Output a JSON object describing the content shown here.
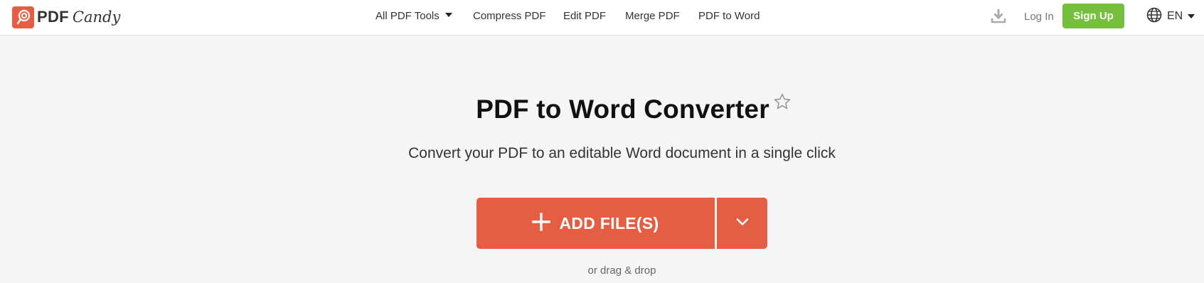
{
  "brand": {
    "name_bold": "PDF",
    "name_italic": "Candy"
  },
  "nav": {
    "all_tools": "All PDF Tools",
    "items": [
      "Compress PDF",
      "Edit PDF",
      "Merge PDF",
      "PDF to Word"
    ]
  },
  "header_right": {
    "login": "Log In",
    "signup": "Sign Up",
    "language": "EN"
  },
  "main": {
    "title": "PDF to Word Converter",
    "subtitle": "Convert your PDF to an editable Word document in a single click",
    "add_files_label": "ADD FILE(S)",
    "drag_hint": "or drag & drop"
  },
  "colors": {
    "brand": "#e55d42",
    "signup": "#74bf3b",
    "background": "#f5f5f5"
  },
  "icons": [
    "pdfcandy-logo-icon",
    "caret-down-icon",
    "download-icon",
    "globe-icon",
    "star-icon",
    "plus-icon",
    "chevron-down-icon"
  ]
}
